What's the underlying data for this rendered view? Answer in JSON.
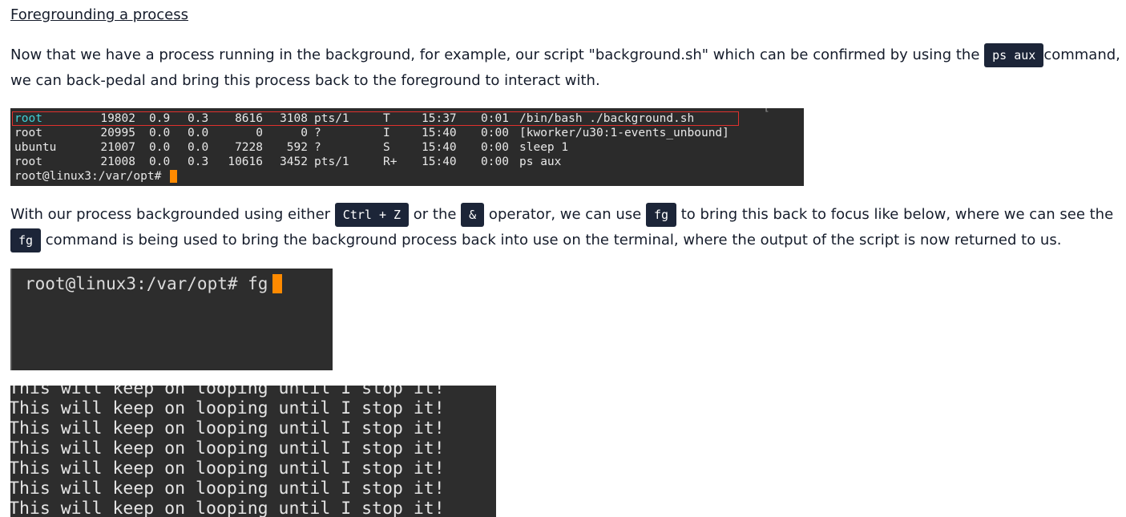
{
  "section": {
    "heading": "Foregrounding a process"
  },
  "paragraph1": {
    "text_before": "Now that we have a process running in the background, for example, our script \"background.sh\" which can be confirmed by using the ",
    "code": "ps aux",
    "text_after": "command, we can back-pedal and bring this process back to the foreground to interact with."
  },
  "ps_terminal": {
    "cut_line": "                                                                                                           [          ]   ]",
    "rows": [
      {
        "user": "root",
        "pid": "19802",
        "cpu": "0.9",
        "mem": "0.3",
        "vsz": "8616",
        "rss": "3108",
        "tty": "pts/1",
        "stat": "T",
        "start": "15:37",
        "time": "0:01",
        "command": "/bin/bash ./background.sh",
        "highlighted": true
      },
      {
        "user": "root",
        "pid": "20995",
        "cpu": "0.0",
        "mem": "0.0",
        "vsz": "0",
        "rss": "0",
        "tty": "?",
        "stat": "I",
        "start": "15:40",
        "time": "0:00",
        "command": "[kworker/u30:1-events_unbound]",
        "highlighted": false
      },
      {
        "user": "ubuntu",
        "pid": "21007",
        "cpu": "0.0",
        "mem": "0.0",
        "vsz": "7228",
        "rss": "592",
        "tty": "?",
        "stat": "S",
        "start": "15:40",
        "time": "0:00",
        "command": "sleep 1",
        "highlighted": false
      },
      {
        "user": "root",
        "pid": "21008",
        "cpu": "0.0",
        "mem": "0.3",
        "vsz": "10616",
        "rss": "3452",
        "tty": "pts/1",
        "stat": "R+",
        "start": "15:40",
        "time": "0:00",
        "command": "ps aux",
        "highlighted": false
      }
    ],
    "prompt": "root@linux3:/var/opt# ",
    "highlight_color": "#e0312e",
    "user_highlight_color": "#3fd0d6",
    "cursor_color": "#ff8a00"
  },
  "paragraph2": {
    "text1": "With our process backgrounded using either ",
    "code1": "Ctrl + Z",
    "text2": " or the ",
    "code2": "&",
    "text3": " operator, we can use ",
    "code3": "fg",
    "text4": " to bring this back to focus like below, where we can see the ",
    "code4": "fg",
    "text5": " command is being used to bring the background process back into use on the terminal, where the output of the script is now returned to us."
  },
  "fg_terminal": {
    "prompt": "root@linux3:/var/opt# fg"
  },
  "loop_terminal": {
    "lines": [
      "This will keep on looping until I stop it!",
      "This will keep on looping until I stop it!",
      "This will keep on looping until I stop it!",
      "This will keep on looping until I stop it!",
      "This will keep on looping until I stop it!",
      "This will keep on looping until I stop it!",
      "This will keep on looping until I stop it!"
    ]
  }
}
